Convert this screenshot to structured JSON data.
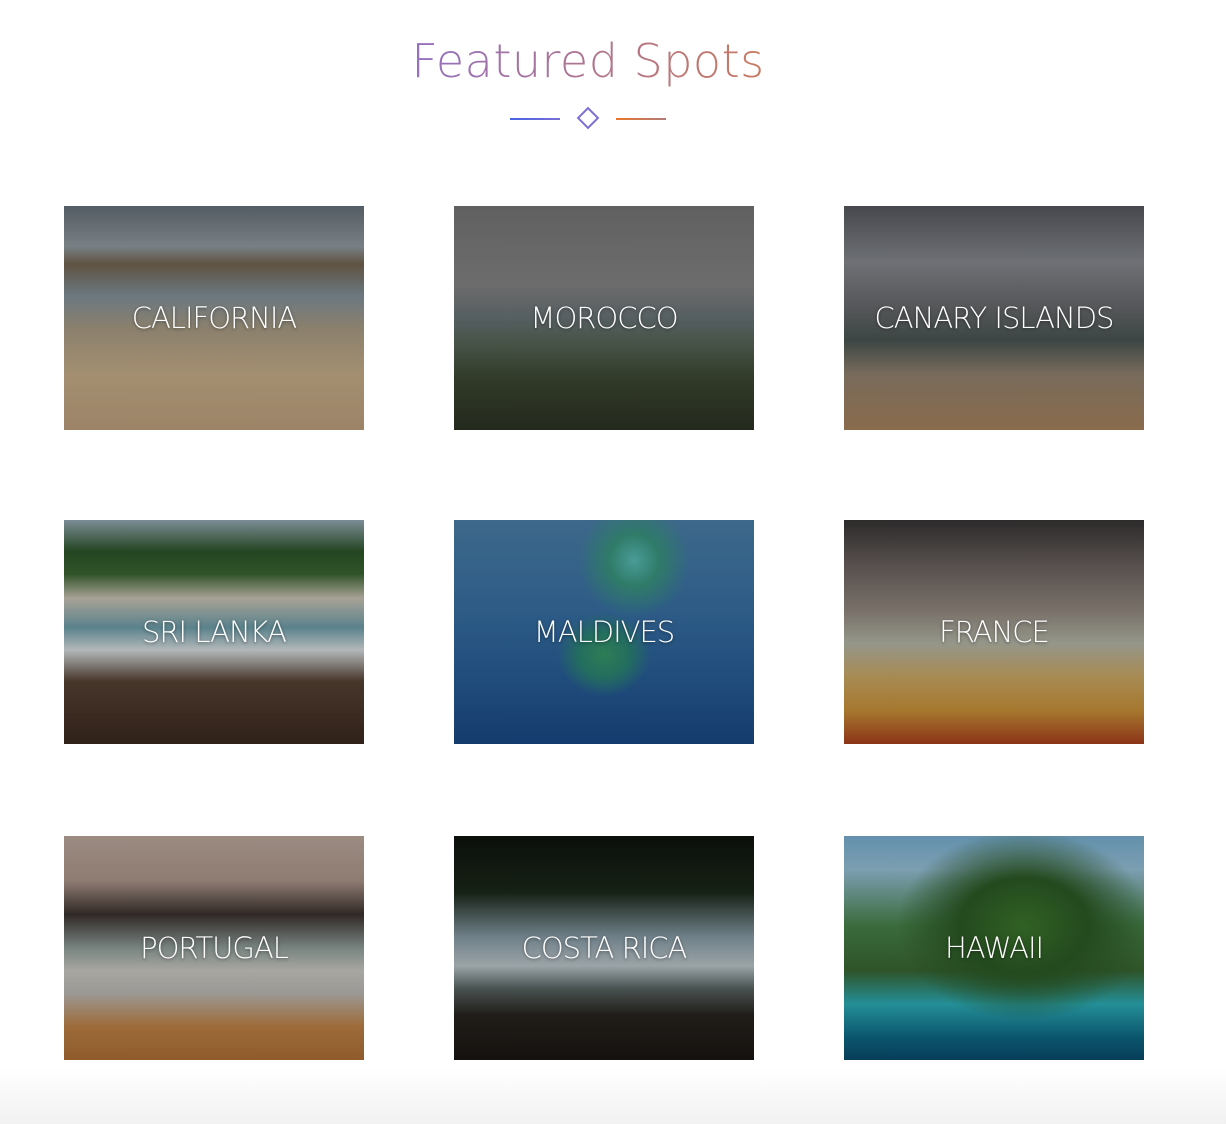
{
  "section": {
    "title": "Featured Spots"
  },
  "spots": [
    {
      "label": "CALIFORNIA"
    },
    {
      "label": "MOROCCO"
    },
    {
      "label": "CANARY ISLANDS"
    },
    {
      "label": "SRI LANKA"
    },
    {
      "label": "MALDIVES"
    },
    {
      "label": "FRANCE"
    },
    {
      "label": "PORTUGAL"
    },
    {
      "label": "COSTA RICA"
    },
    {
      "label": "HAWAII"
    }
  ],
  "colors": {
    "title_gradient_start": "#5b6fe0",
    "title_gradient_end": "#ea7f2a"
  }
}
